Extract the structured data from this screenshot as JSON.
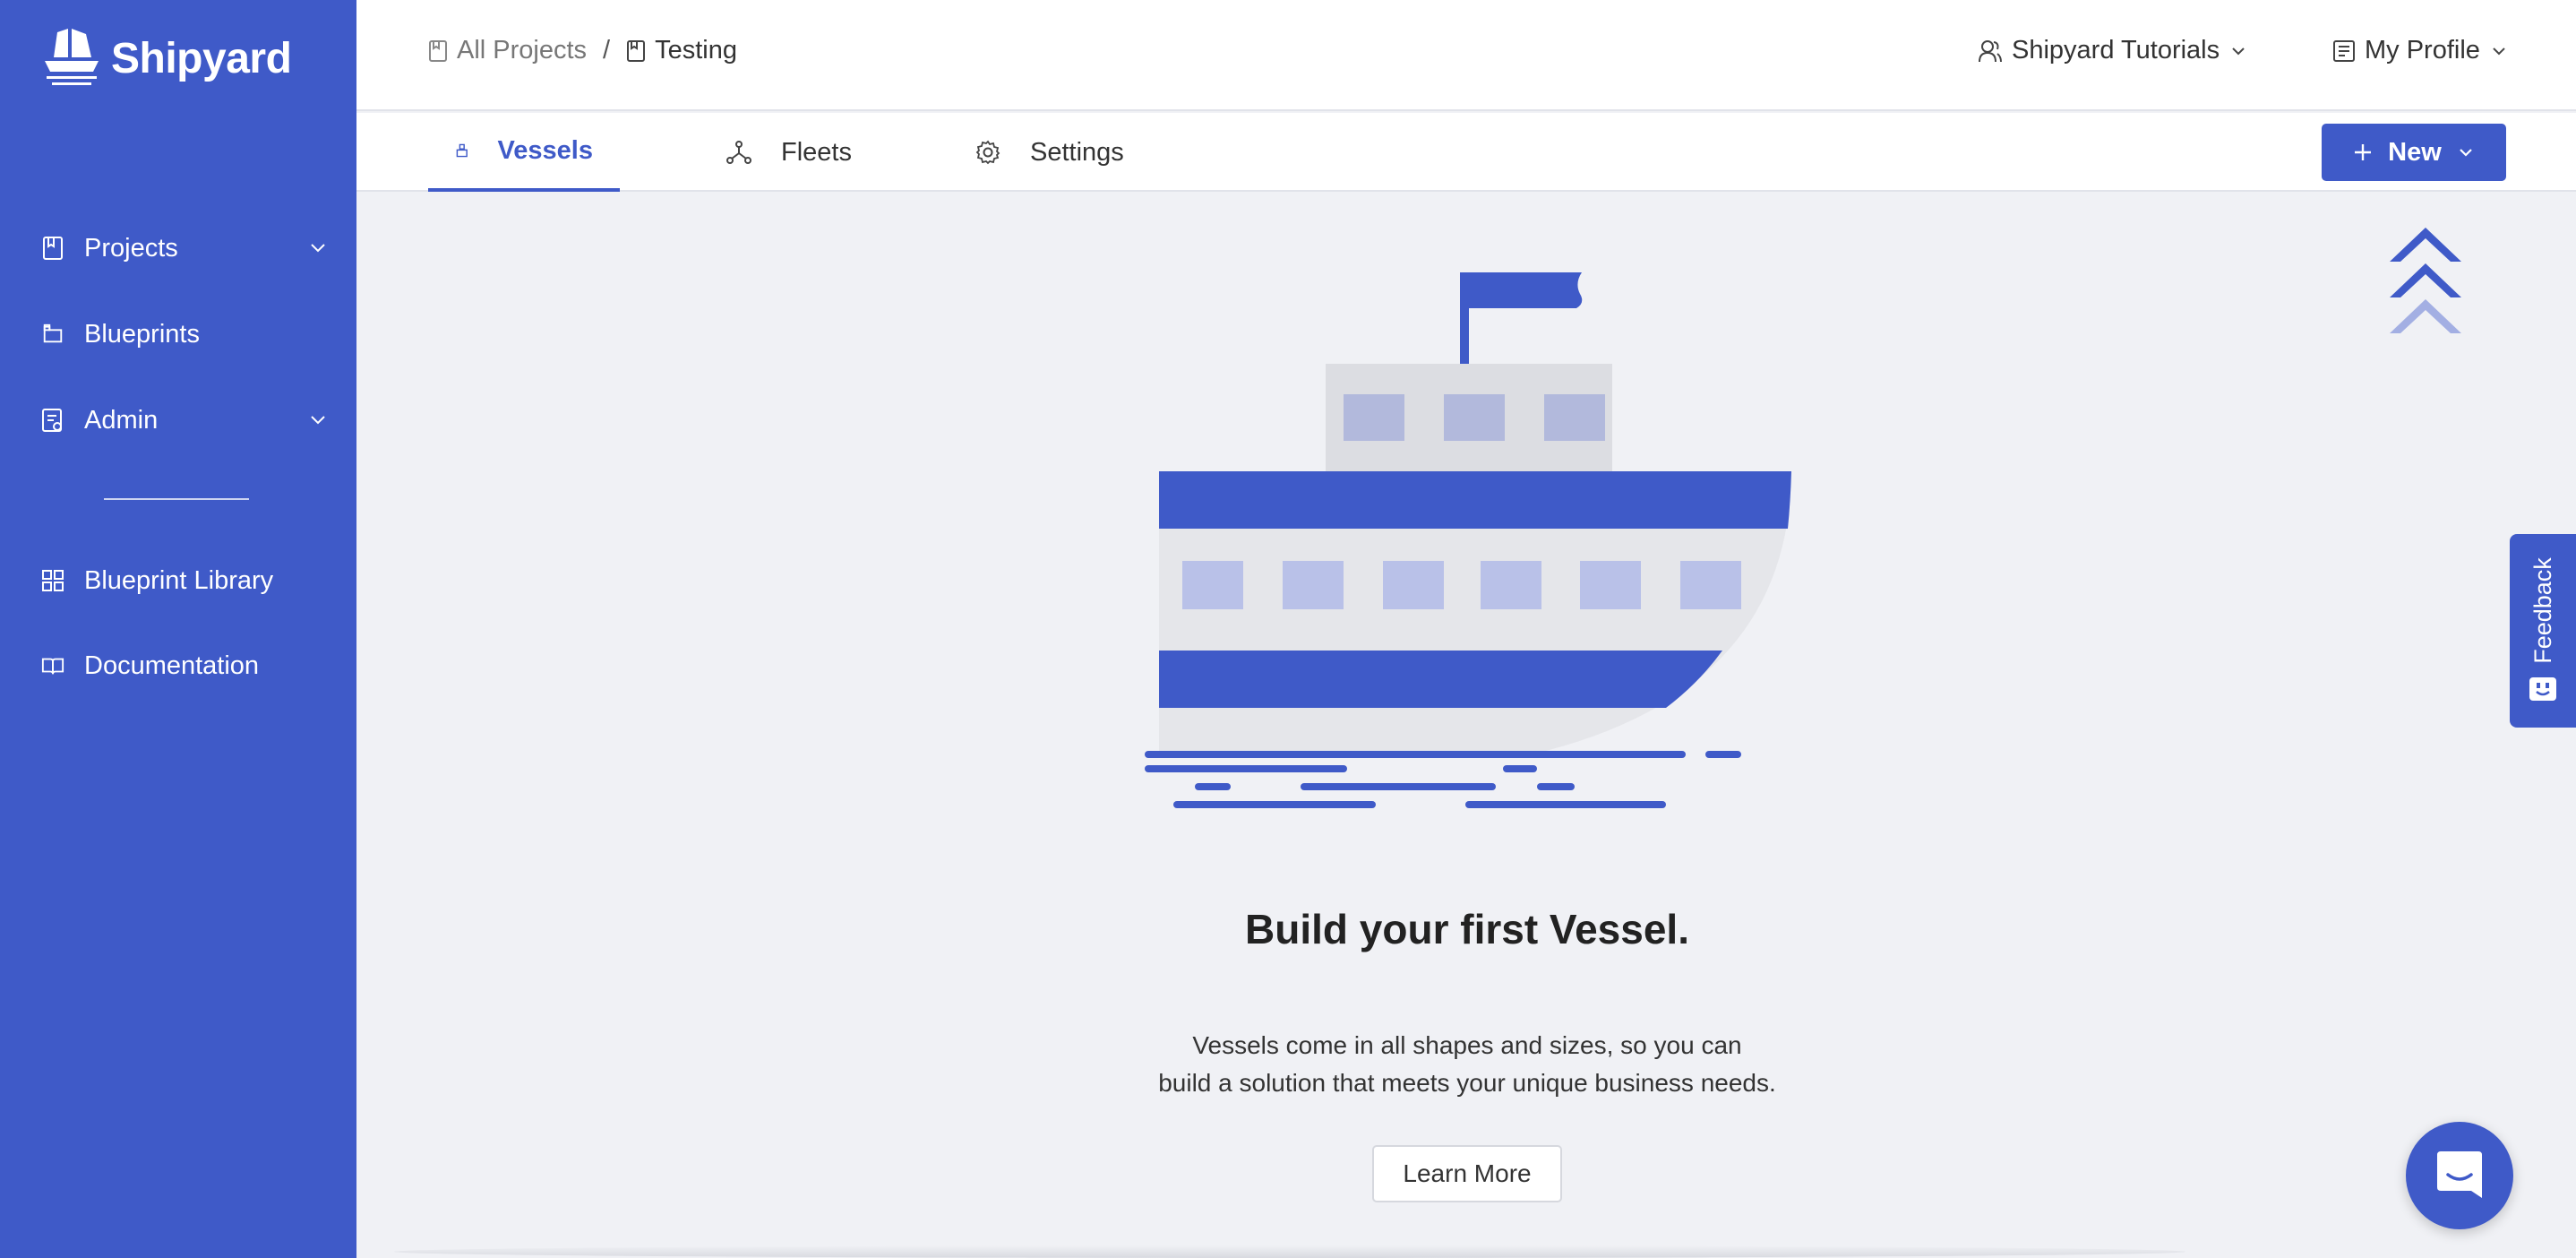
{
  "brand": {
    "name": "Shipyard"
  },
  "sidebar": {
    "items": [
      {
        "label": "Projects",
        "icon": "book-icon",
        "has_chevron": true
      },
      {
        "label": "Blueprints",
        "icon": "blueprint-icon",
        "has_chevron": false
      },
      {
        "label": "Admin",
        "icon": "admin-icon",
        "has_chevron": true
      },
      {
        "label": "Blueprint Library",
        "icon": "grid-icon",
        "has_chevron": false
      },
      {
        "label": "Documentation",
        "icon": "open-book-icon",
        "has_chevron": false
      }
    ]
  },
  "header": {
    "breadcrumb": [
      {
        "label": "All Projects"
      },
      {
        "label": "Testing"
      }
    ],
    "breadcrumb_separator": "/",
    "org_menu": "Shipyard Tutorials",
    "profile_menu": "My Profile"
  },
  "tabs": [
    {
      "label": "Vessels",
      "icon": "vessel-icon",
      "active": true
    },
    {
      "label": "Fleets",
      "icon": "fleet-icon",
      "active": false
    },
    {
      "label": "Settings",
      "icon": "gear-icon",
      "active": false
    }
  ],
  "new_button": {
    "label": "New"
  },
  "empty_state": {
    "title": "Build your first Vessel.",
    "description_line1": "Vessels come in all shapes and sizes, so you can",
    "description_line2": "build a solution that meets your unique business needs.",
    "learn_more": "Learn More"
  },
  "feedback": {
    "label": "Feedback"
  },
  "colors": {
    "brand": "#3f5ac8",
    "background": "#f0f1f5",
    "ship_hull": "#e5e6ea",
    "ship_window": "#b9c1e8"
  }
}
